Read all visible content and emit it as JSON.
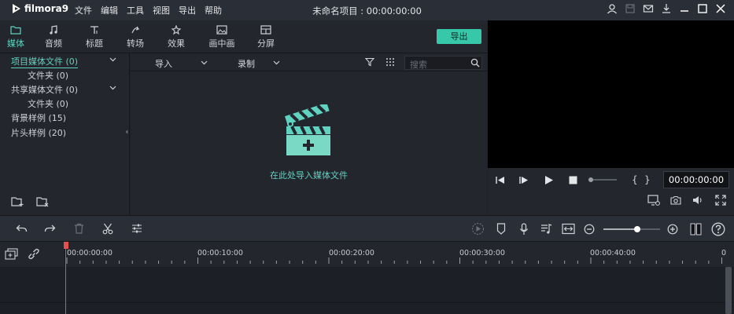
{
  "app": {
    "logo_text": "filmora9",
    "project_title": "未命名项目 : 00:00:00:00",
    "menu": [
      "文件",
      "编辑",
      "工具",
      "视图",
      "导出",
      "帮助"
    ]
  },
  "toolbar": {
    "tabs": [
      {
        "label": "媒体",
        "icon": "folder-icon",
        "active": true
      },
      {
        "label": "音频",
        "icon": "music-note-icon",
        "active": false
      },
      {
        "label": "标题",
        "icon": "text-icon",
        "active": false
      },
      {
        "label": "转场",
        "icon": "transition-icon",
        "active": false
      },
      {
        "label": "效果",
        "icon": "effects-icon",
        "active": false
      },
      {
        "label": "画中画",
        "icon": "pip-icon",
        "active": false
      },
      {
        "label": "分屏",
        "icon": "split-screen-icon",
        "active": false
      }
    ],
    "export_label": "导出"
  },
  "media_tree": {
    "project_media": "项目媒体文件 (0)",
    "project_folder": "文件夹 (0)",
    "shared_media": "共享媒体文件 (0)",
    "shared_folder": "文件夹 (0)",
    "bg_samples": "背景样例 (15)",
    "intro_samples": "片头样例 (20)"
  },
  "media_bar": {
    "import_label": "导入",
    "record_label": "录制",
    "search_placeholder": "搜索"
  },
  "media_empty": {
    "hint": "在此处导入媒体文件"
  },
  "preview": {
    "timecode": "00:00:00:00",
    "bracket_left": "{",
    "bracket_right": "}"
  },
  "timeline": {
    "ticks": [
      "00:00:00:00",
      "00:00:10:00",
      "00:00:20:00",
      "00:00:30:00",
      "00:00:40:00",
      "0"
    ]
  },
  "colors": {
    "accent": "#37c8a9",
    "accent_text": "#5fd3c0",
    "playhead": "#e0524b",
    "background": "#1f2229"
  }
}
